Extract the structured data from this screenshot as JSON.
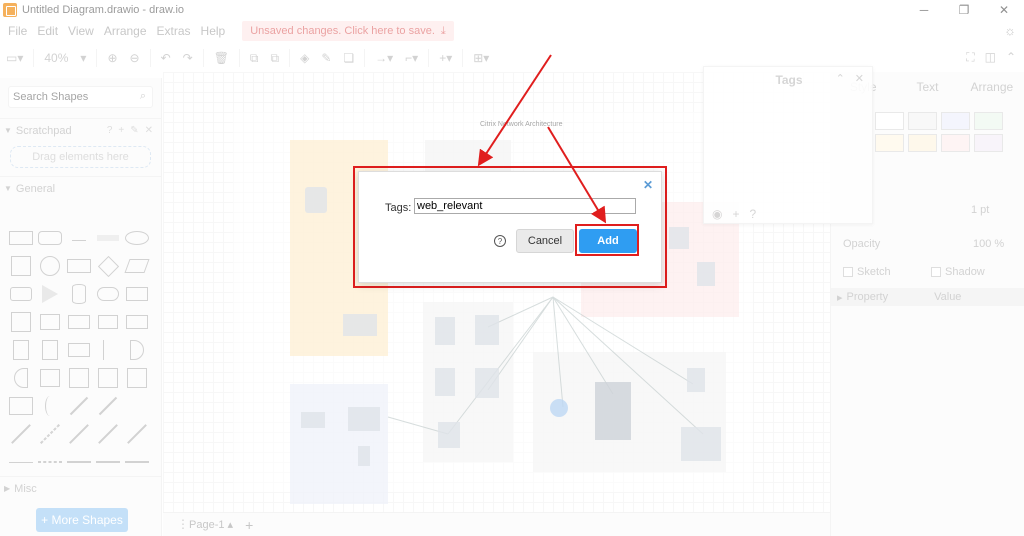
{
  "window": {
    "title": "Untitled Diagram.drawio - draw.io"
  },
  "menu": {
    "items": [
      "File",
      "Edit",
      "View",
      "Arrange",
      "Extras",
      "Help"
    ],
    "unsaved_banner": "Unsaved changes. Click here to save."
  },
  "toolbar": {
    "zoom": "40%"
  },
  "left_panel": {
    "search_placeholder": "Search Shapes",
    "scratchpad_label": "Scratchpad",
    "drag_hint": "Drag elements here",
    "general_label": "General",
    "misc_label": "Misc",
    "more_shapes": "+ More Shapes"
  },
  "right_panel": {
    "tabs": [
      "Style",
      "Text",
      "Arrange"
    ],
    "line_width": "1 pt",
    "opacity_label": "Opacity",
    "opacity_value": "100 %",
    "sketch_label": "Sketch",
    "shadow_label": "Shadow",
    "property_label": "Property",
    "value_label": "Value"
  },
  "tags_panel": {
    "title": "Tags"
  },
  "canvas": {
    "page_tab": "Page-1",
    "diagram_title": "Citrix Network Architecture"
  },
  "dialog": {
    "tags_label": "Tags:",
    "tags_value": "web_relevant",
    "cancel_label": "Cancel",
    "add_label": "Add"
  },
  "colors": {
    "accent": "#2f9df2",
    "highlight": "#e01e1e"
  }
}
